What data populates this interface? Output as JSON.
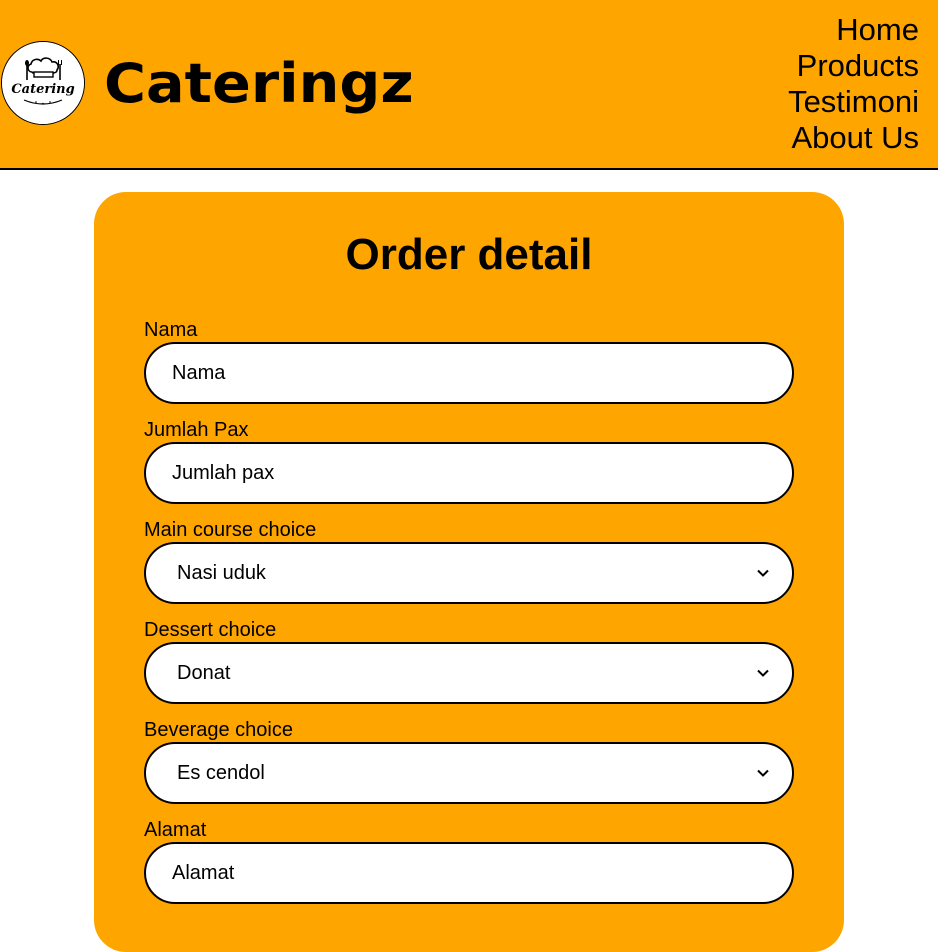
{
  "header": {
    "logo_text": "Catering",
    "brand": "Cateringz",
    "nav": [
      "Home",
      "Products",
      "Testimoni",
      "About Us"
    ],
    "background": "#ffa500"
  },
  "form": {
    "title": "Order detail",
    "nama": {
      "label": "Nama",
      "placeholder": "Nama"
    },
    "jumlah_pax": {
      "label": "Jumlah Pax",
      "placeholder": "Jumlah pax"
    },
    "main_course": {
      "label": "Main course choice",
      "selected": "Nasi uduk"
    },
    "dessert": {
      "label": "Dessert choice",
      "selected": "Donat"
    },
    "beverage": {
      "label": "Beverage choice",
      "selected": "Es cendol"
    },
    "alamat": {
      "label": "Alamat",
      "placeholder": "Alamat"
    }
  },
  "icons": {
    "logo": "catering-chef-hat-logo",
    "select_arrow": "chevron-down-icon"
  }
}
